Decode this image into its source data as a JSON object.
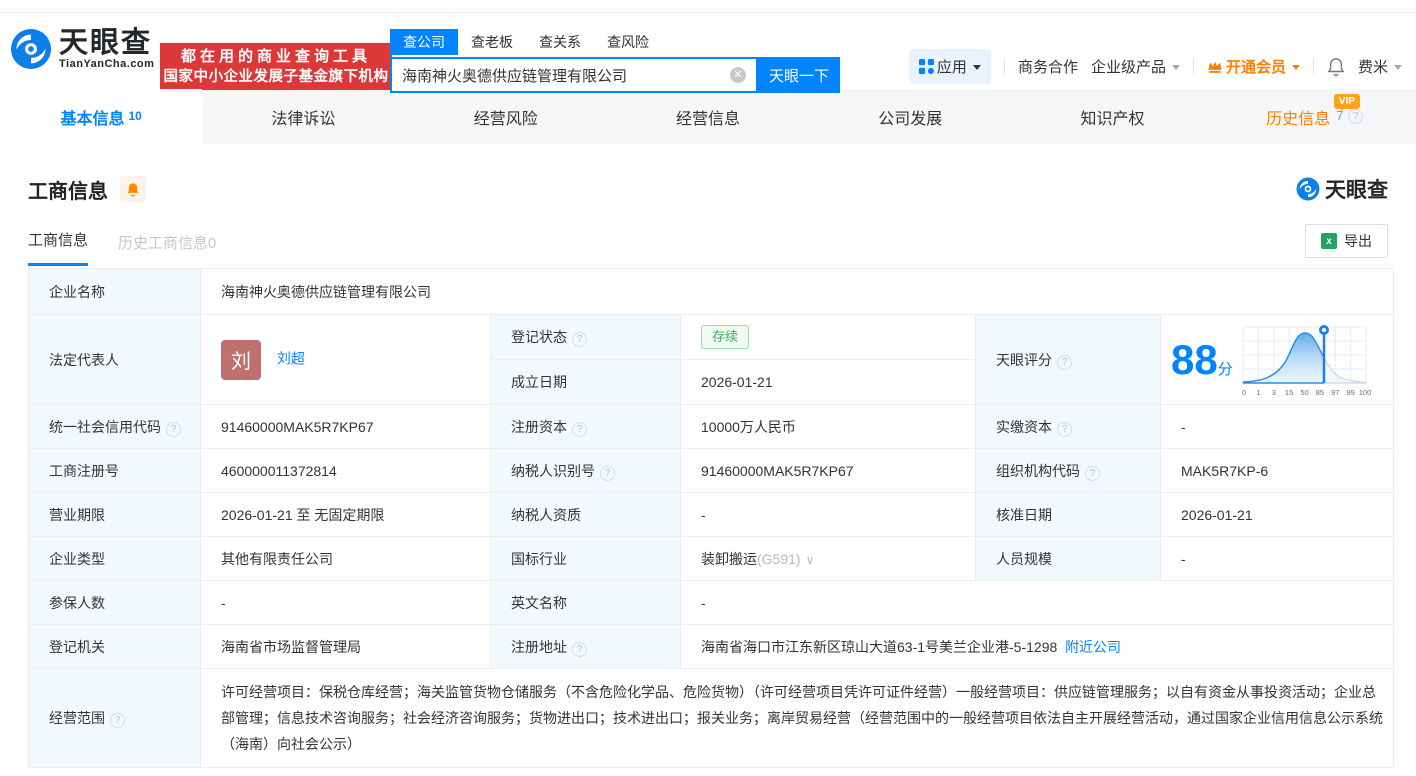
{
  "colors": {
    "accent": "#0084ff",
    "banner_red": "#dd3838",
    "vip_orange": "#ff8000",
    "status_green": "#3eb155"
  },
  "header": {
    "logo": {
      "title": "天眼查",
      "domain": "TianYanCha.com"
    },
    "banner": {
      "line1": "都在用的商业查询工具",
      "line2": "国家中小企业发展子基金旗下机构"
    },
    "search": {
      "tabs": [
        {
          "label": "查公司"
        },
        {
          "label": "查老板"
        },
        {
          "label": "查关系"
        },
        {
          "label": "查风险"
        }
      ],
      "value": "海南神火奥德供应链管理有限公司",
      "button": "天眼一下"
    },
    "nav": {
      "apps": "应用",
      "cooperation": "商务合作",
      "enterprise": "企业级产品",
      "vip": "开通会员",
      "username": "费米"
    }
  },
  "tabs": {
    "basic": {
      "label": "基本信息",
      "count": "10"
    },
    "legal": {
      "label": "法律诉讼"
    },
    "risk": {
      "label": "经营风险"
    },
    "operation": {
      "label": "经营信息"
    },
    "development": {
      "label": "公司发展"
    },
    "ip": {
      "label": "知识产权"
    },
    "history": {
      "label": "历史信息",
      "count": "7",
      "vip": "VIP"
    }
  },
  "section": {
    "title": "工商信息",
    "watermark": "天眼查",
    "subtab_active": "工商信息",
    "subtab_history": "历史工商信息0",
    "export": "导出"
  },
  "table": {
    "company_name_label": "企业名称",
    "company_name": "海南神火奥德供应链管理有限公司",
    "legal_rep_label": "法定代表人",
    "legal_rep_avatar": "刘",
    "legal_rep_name": "刘超",
    "reg_status_label": "登记状态",
    "reg_status": "存续",
    "est_date_label": "成立日期",
    "est_date": "2026-01-21",
    "credit_code_label": "统一社会信用代码",
    "credit_code": "91460000MAK5R7KP67",
    "reg_capital_label": "注册资本",
    "reg_capital": "10000万人民币",
    "paid_capital_label": "实缴资本",
    "paid_capital": "-",
    "reg_number_label": "工商注册号",
    "reg_number": "460000011372814",
    "taxpayer_id_label": "纳税人识别号",
    "taxpayer_id": "91460000MAK5R7KP67",
    "org_code_label": "组织机构代码",
    "org_code": "MAK5R7KP-6",
    "term_label": "营业期限",
    "term": "2026-01-21 至 无固定期限",
    "taxpayer_quality_label": "纳税人资质",
    "taxpayer_quality": "-",
    "approval_date_label": "核准日期",
    "approval_date": "2026-01-21",
    "type_label": "企业类型",
    "type": "其他有限责任公司",
    "industry_label": "国标行业",
    "industry": "装卸搬运",
    "industry_code": "(G591)",
    "staff_label": "人员规模",
    "staff": "-",
    "insured_label": "参保人数",
    "insured": "-",
    "en_name_label": "英文名称",
    "en_name": "-",
    "authority_label": "登记机关",
    "authority": "海南省市场监督管理局",
    "address_label": "注册地址",
    "address": "海南省海口市江东新区琼山大道63-1号美兰企业港-5-1298",
    "nearby": "附近公司",
    "scope_label": "经营范围",
    "scope": "许可经营项目：保税仓库经营；海关监管货物仓储服务（不含危险化学品、危险货物）（许可经营项目凭许可证件经营）一般经营项目：供应链管理服务；以自有资金从事投资活动；企业总部管理；信息技术咨询服务；社会经济咨询服务；货物进出口；技术进出口；报关业务；离岸贸易经营（经营范围中的一般经营项目依法自主开展经营活动，通过国家企业信用信息公示系统（海南）向社会公示）"
  },
  "score": {
    "label": "天眼评分",
    "value": "88",
    "unit": "分",
    "axis": [
      "0",
      "1",
      "3",
      "15",
      "50",
      "85",
      "97",
      "99",
      "100"
    ]
  }
}
